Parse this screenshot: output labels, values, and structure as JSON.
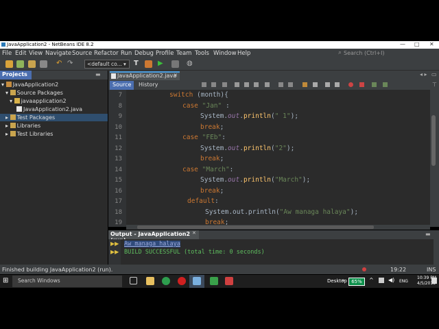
{
  "window": {
    "title": "JavaApplication2 - NetBeans IDE 8.2",
    "min": "—",
    "max": "□",
    "close": "✕"
  },
  "menu": [
    "File",
    "Edit",
    "View",
    "Navigate",
    "Source",
    "Refactor",
    "Run",
    "Debug",
    "Profile",
    "Team",
    "Tools",
    "Window",
    "Help"
  ],
  "search": {
    "placeholder": "Search (Ctrl+I)"
  },
  "toolbar": {
    "config_value": "<default co..."
  },
  "projects": {
    "tab_label": "Projects",
    "tree": [
      {
        "label": "JavaApplication2"
      },
      {
        "label": "Source Packages"
      },
      {
        "label": "javaapplication2"
      },
      {
        "label": "JavaApplication2.java"
      },
      {
        "label": "Test Packages"
      },
      {
        "label": "Libraries"
      },
      {
        "label": "Test Libraries"
      }
    ]
  },
  "editor": {
    "file_tab": "JavaApplication2.java",
    "source_tab": "Source",
    "history_tab": "History",
    "line_numbers": [
      "7",
      "8",
      "9",
      "10",
      "11",
      "12",
      "13",
      "14",
      "15",
      "16",
      "17",
      "18",
      "19"
    ],
    "code": {
      "l7": {
        "kw": "switch",
        "rest": " (month){"
      },
      "l8": {
        "kw": "case",
        "str": "\"Jan\"",
        "rest": " :"
      },
      "l9": {
        "pre": "System.",
        "field": "out",
        "dot": ".",
        "method": "println",
        "open": "(",
        "str": "\" 1\"",
        "close": ");"
      },
      "l10": {
        "kw": "break",
        "rest": ";"
      },
      "l11": {
        "kw": "case",
        "str": "\"FEb\"",
        "rest": ":"
      },
      "l12": {
        "pre": "System.",
        "field": "out",
        "dot": ".",
        "method": "println",
        "open": "(",
        "str": "\"2\"",
        "close": ");"
      },
      "l13": {
        "kw": "break",
        "rest": ";"
      },
      "l14": {
        "kw": "case",
        "str": "\"March\"",
        "rest": ":"
      },
      "l15": {
        "pre": "System.",
        "field": "out",
        "dot": ".",
        "method": "println",
        "open": "(",
        "str": "\"March\"",
        "close": ");"
      },
      "l16": {
        "kw": "break",
        "rest": ";"
      },
      "l17": {
        "kw": "default",
        "rest": ":"
      },
      "l18": {
        "pre": "System.out.println(",
        "str": "\"Aw managa halaya\"",
        "close": ");"
      },
      "l19": {
        "kw": "break",
        "rest": ";"
      }
    }
  },
  "output": {
    "tab_label": "Output - JavaApplication2 (run)",
    "line1": "Aw managa halaya",
    "line2": "BUILD SUCCESSFUL (total time: 0 seconds)"
  },
  "status": {
    "message": "Finished building JavaApplication2 (run).",
    "position": "19:22",
    "mode": "INS"
  },
  "taskbar": {
    "search_label": "Search Windows",
    "desktop": "Desktop",
    "battery": "65%",
    "lang": "ENG",
    "time": "10:39 PM",
    "date": "4/5/2018"
  },
  "colors": {
    "accent": "#4b6eaf",
    "keyword": "#cc7832",
    "string": "#6a8759",
    "method": "#ffc66d",
    "field": "#9876aa"
  }
}
